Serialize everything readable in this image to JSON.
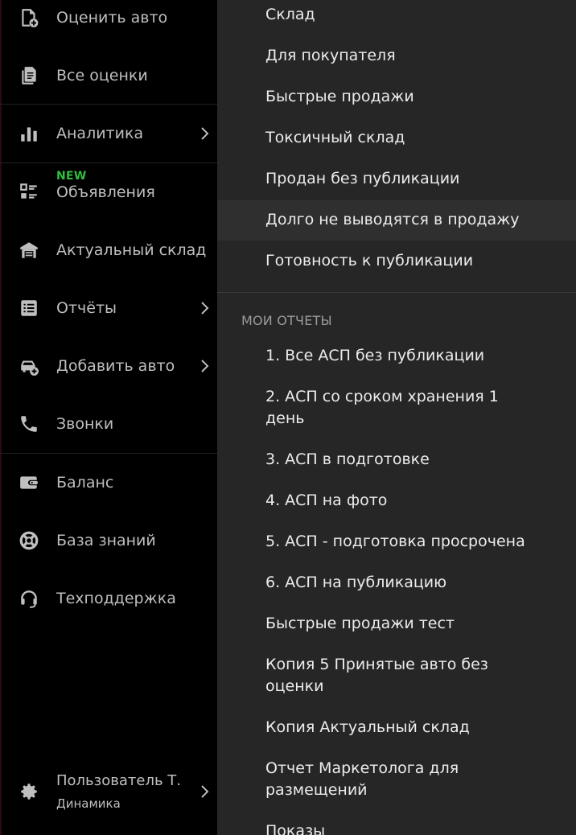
{
  "sidebar": {
    "items": [
      {
        "label": "Оценить авто",
        "icon": "file-plus-icon"
      },
      {
        "label": "Все оценки",
        "icon": "documents-icon"
      },
      {
        "label": "Аналитика",
        "icon": "bar-chart-icon"
      },
      {
        "label": "Объявления",
        "icon": "list-icon",
        "badge": "NEW"
      },
      {
        "label": "Актуальный склад",
        "icon": "warehouse-icon"
      },
      {
        "label": "Отчёты",
        "icon": "report-table-icon"
      },
      {
        "label": "Добавить авто",
        "icon": "car-plus-icon"
      },
      {
        "label": "Звонки",
        "icon": "phone-icon"
      },
      {
        "label": "Баланс",
        "icon": "wallet-icon"
      },
      {
        "label": "База знаний",
        "icon": "lifebuoy-icon"
      },
      {
        "label": "Техподдержка",
        "icon": "headset-icon"
      }
    ],
    "user": {
      "name": "Пользователь Т.",
      "org": "Динамика",
      "icon": "gear-icon"
    }
  },
  "panel": {
    "items": [
      "Склад",
      "Для покупателя",
      "Быстрые продажи",
      "Токсичный склад",
      "Продан без публикации",
      "Долго не выводятся в продажу",
      "Готовность к публикации"
    ],
    "section_title": "МОИ ОТЧЕТЫ",
    "reports": [
      "1. Все АСП без публикации",
      "2. АСП со сроком хранения 1 день",
      "3. АСП в подготовке",
      "4. АСП на фото",
      "5. АСП - подготовка просрочена",
      "6. АСП на публикацию",
      "Быстрые продажи тест",
      "Копия 5 Принятые авто без оценки",
      "Копия Актуальный склад",
      "Отчет Маркетолога для размещений",
      "Показы"
    ]
  },
  "colors": {
    "sidebar_bg": "#000000",
    "panel_bg": "#262626",
    "badge": "#2fbf3c",
    "active_row": "#2f2f2f"
  }
}
